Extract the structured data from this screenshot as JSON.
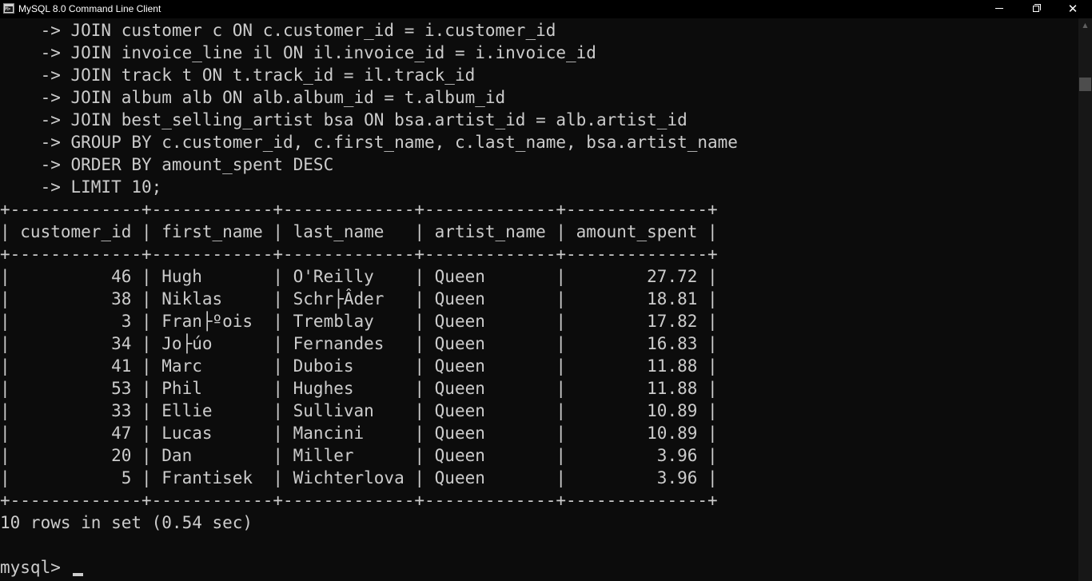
{
  "window": {
    "title": "MySQL 8.0 Command Line Client",
    "app_icon_text": "M>",
    "buttons": {
      "minimize": "minimize",
      "maximize": "restore",
      "close": "✕"
    }
  },
  "console": {
    "lines": [
      "    -> JOIN customer c ON c.customer_id = i.customer_id",
      "    -> JOIN invoice_line il ON il.invoice_id = i.invoice_id",
      "    -> JOIN track t ON t.track_id = il.track_id",
      "    -> JOIN album alb ON alb.album_id = t.album_id",
      "    -> JOIN best_selling_artist bsa ON bsa.artist_id = alb.artist_id",
      "    -> GROUP BY c.customer_id, c.first_name, c.last_name, bsa.artist_name",
      "    -> ORDER BY amount_spent DESC",
      "    -> LIMIT 10;",
      "+-------------+------------+-------------+-------------+--------------+",
      "| customer_id | first_name | last_name   | artist_name | amount_spent |",
      "+-------------+------------+-------------+-------------+--------------+",
      "|          46 | Hugh       | O'Reilly    | Queen       |        27.72 |",
      "|          38 | Niklas     | Schr├Âder   | Queen       |        18.81 |",
      "|           3 | Fran├ºois  | Tremblay    | Queen       |        17.82 |",
      "|          34 | Jo├úo      | Fernandes   | Queen       |        16.83 |",
      "|          41 | Marc       | Dubois      | Queen       |        11.88 |",
      "|          53 | Phil       | Hughes      | Queen       |        11.88 |",
      "|          33 | Ellie      | Sullivan    | Queen       |        10.89 |",
      "|          47 | Lucas      | Mancini     | Queen       |        10.89 |",
      "|          20 | Dan        | Miller      | Queen       |         3.96 |",
      "|           5 | Frantisek  | Wichterlova | Queen       |         3.96 |",
      "+-------------+------------+-------------+-------------+--------------+",
      "10 rows in set (0.54 sec)",
      "",
      "mysql> "
    ]
  },
  "scrollbar": {
    "up_arrow": "▲"
  },
  "colors": {
    "background": "#0c0c0c",
    "text": "#cccccc",
    "titlebar": "#000000"
  }
}
